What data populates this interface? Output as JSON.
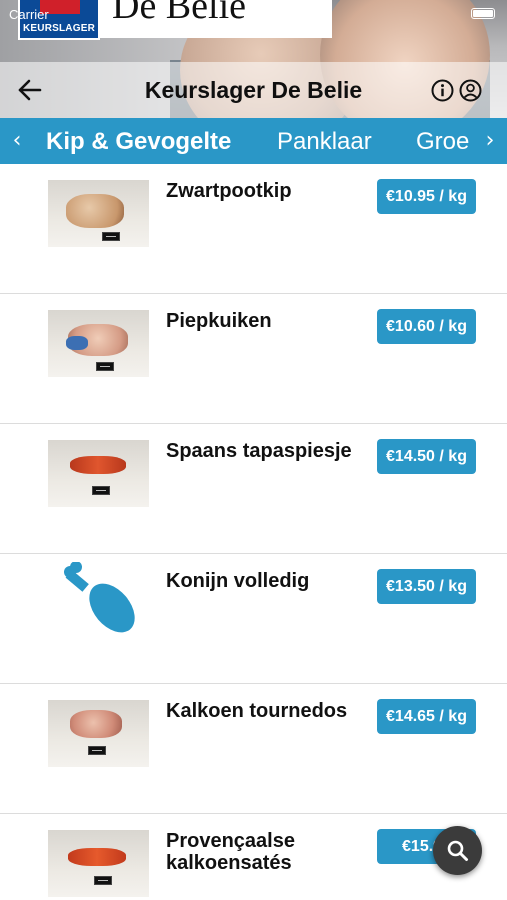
{
  "status_bar": {
    "carrier": "Carrier"
  },
  "brand": {
    "logo_text": "KEURSLAGER",
    "banner_text": "De Belie"
  },
  "nav": {
    "title": "Keurslager De Belie",
    "back_icon": "back-arrow-icon",
    "info_icon": "info-icon",
    "user_icon": "user-icon"
  },
  "tabs": {
    "items": [
      {
        "label": "Kip & Gevogelte",
        "active": true
      },
      {
        "label": "Panklaar",
        "active": false
      },
      {
        "label": "Groe",
        "active": false
      }
    ],
    "left_icon": "chevron-left-icon",
    "right_icon": "chevron-right-icon"
  },
  "products": [
    {
      "name": "Zwartpootkip",
      "price": "€10.95 / kg",
      "image": "photo"
    },
    {
      "name": "Piepkuiken",
      "price": "€10.60 / kg",
      "image": "photo"
    },
    {
      "name": "Spaans tapaspiesje",
      "price": "€14.50 / kg",
      "image": "photo"
    },
    {
      "name": "Konijn volledig",
      "price": "€13.50 / kg",
      "image": "drumstick-icon"
    },
    {
      "name": "Kalkoen tournedos",
      "price": "€14.65 / kg",
      "image": "photo"
    },
    {
      "name": "Provençaalse kalkoensatés",
      "price": "€15.95",
      "image": "photo"
    }
  ],
  "fab": {
    "icon": "search-icon"
  },
  "colors": {
    "accent": "#2a97c7",
    "fab": "#3b3b3b",
    "divider": "#dcdcdc"
  }
}
